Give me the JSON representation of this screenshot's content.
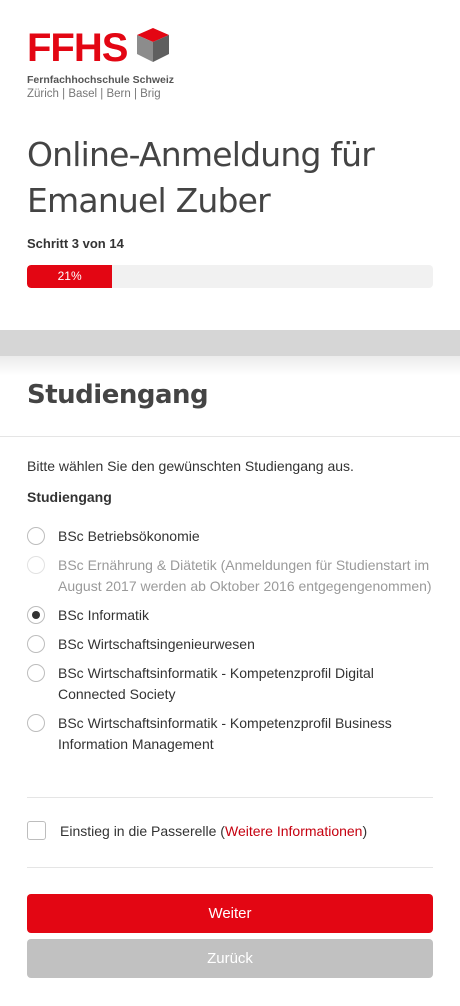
{
  "brand": {
    "logo_text": "FFHS",
    "subtitle": "Fernfachhochschule Schweiz",
    "locations": "Zürich | Basel | Bern | Brig",
    "accent_color": "#e30613"
  },
  "header": {
    "title": "Online-Anmeldung für Emanuel Zuber",
    "step": "Schritt 3 von 14",
    "progress_label": "21%",
    "progress_percent": 21
  },
  "section": {
    "title": "Studiengang",
    "intro": "Bitte wählen Sie den gewünschten Studiengang aus.",
    "field_label": "Studiengang"
  },
  "options": [
    {
      "label": "BSc Betriebsökonomie",
      "checked": false,
      "disabled": false
    },
    {
      "label": "BSc Ernährung & Diätetik (Anmeldungen für Studienstart im August 2017 werden ab Oktober 2016 entgegengenommen)",
      "checked": false,
      "disabled": true
    },
    {
      "label": "BSc Informatik",
      "checked": true,
      "disabled": false
    },
    {
      "label": "BSc Wirtschaftsingenieurwesen",
      "checked": false,
      "disabled": false
    },
    {
      "label": "BSc Wirtschaftsinformatik - Kompetenzprofil Digital Connected Society",
      "checked": false,
      "disabled": false
    },
    {
      "label": "BSc Wirtschaftsinformatik - Kompetenzprofil Business Information Management",
      "checked": false,
      "disabled": false
    }
  ],
  "passerelle": {
    "label_before": "Einstieg in die Passerelle (",
    "link_text": "Weitere Informationen",
    "label_after": ")",
    "checked": false
  },
  "buttons": {
    "next": "Weiter",
    "back": "Zurück"
  }
}
